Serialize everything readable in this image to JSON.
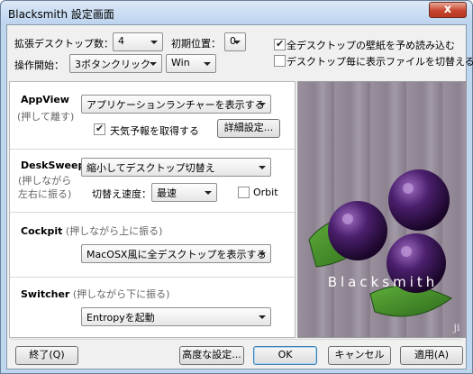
{
  "window": {
    "title": "Blacksmith 設定画面",
    "close": "x"
  },
  "top": {
    "desktops_label": "拡張デスクトップ数：",
    "desktops_value": "4",
    "initial_label": "初期位置：",
    "initial_value": "0",
    "op_start_label": "操作開始：",
    "op_start_value": "3ボタンクリック",
    "key_value": "Win",
    "preload_label": "全デスクトップの壁紙を予め読み込む",
    "preload_checked": true,
    "perdesk_label": "デスクトップ毎に表示ファイルを切替える",
    "perdesk_checked": false
  },
  "appview": {
    "title": "AppView",
    "hint": "(押して離す)",
    "mode_value": "アプリケーションランチャーを表示する",
    "weather_label": "天気予報を取得する",
    "weather_checked": true,
    "detail_button": "詳細設定..."
  },
  "desksweep": {
    "title": "DeskSweep",
    "hint_line1": "(押しながら",
    "hint_line2": "左右に振る)",
    "mode_value": "縮小してデスクトップ切替え",
    "speed_label": "切替え速度：",
    "speed_value": "最速",
    "orbit_label": "Orbit",
    "orbit_checked": false
  },
  "cockpit": {
    "title": "Cockpit",
    "hint": "(押しながら上に振る)",
    "mode_value": "MacOSX風に全デスクトップを表示する"
  },
  "switcher": {
    "title": "Switcher",
    "hint": "(押しながら下に振る)",
    "mode_value": "Entropyを起動"
  },
  "image": {
    "logo_text": "Blacksmith",
    "signature": "ji"
  },
  "buttons": {
    "exit": "終了(Q)",
    "advanced": "高度な設定...",
    "ok": "OK",
    "cancel": "キャンセル",
    "apply": "適用(A)"
  }
}
